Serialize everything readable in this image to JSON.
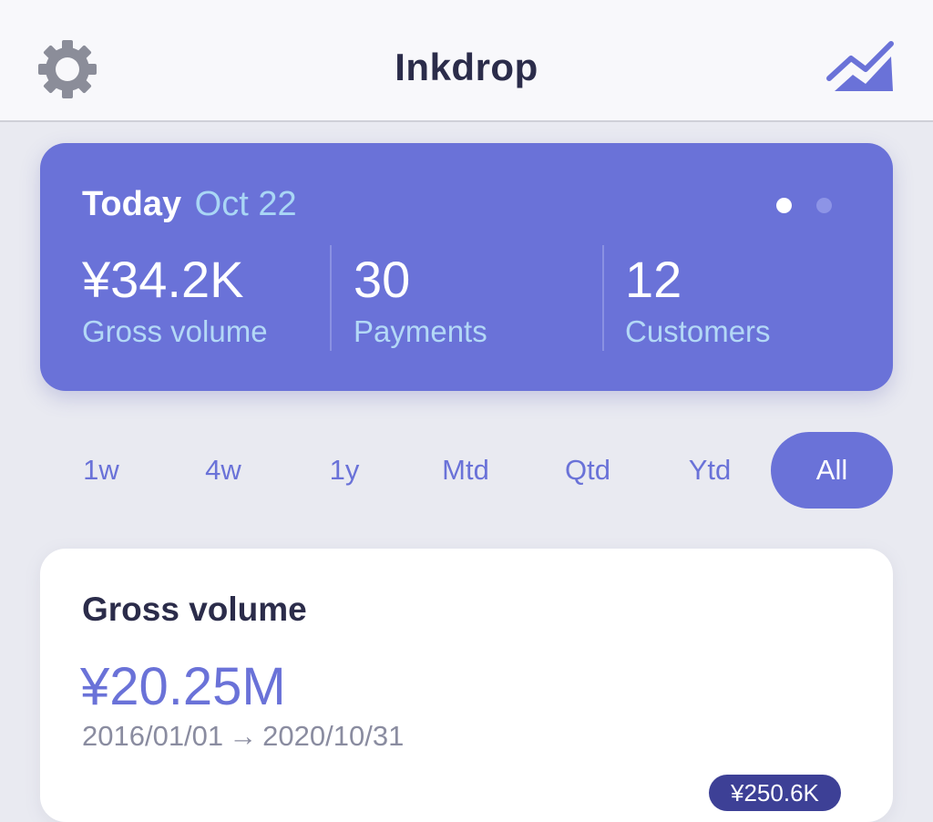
{
  "header": {
    "title": "Inkdrop",
    "left_icon": "gear-icon",
    "right_icon": "chart-icon"
  },
  "summary": {
    "label": "Today",
    "date": "Oct 22",
    "pager": {
      "count": 2,
      "active_index": 0
    },
    "stats": [
      {
        "value": "¥34.2K",
        "label": "Gross volume"
      },
      {
        "value": "30",
        "label": "Payments"
      },
      {
        "value": "12",
        "label": "Customers"
      }
    ]
  },
  "periods": {
    "options": [
      "1w",
      "4w",
      "1y",
      "Mtd",
      "Qtd",
      "Ytd",
      "All"
    ],
    "selected": "All"
  },
  "gross_volume": {
    "title": "Gross volume",
    "amount": "¥20.25M",
    "start_date": "2016/01/01",
    "end_date": "2020/10/31",
    "badge": "¥250.6K"
  },
  "colors": {
    "accent": "#6a72d8",
    "background": "#e9eaf1",
    "title_text": "#2b2c4a",
    "muted_text": "#8a8ca0",
    "label_blue": "#b3d8f6",
    "badge": "#3d4096"
  }
}
